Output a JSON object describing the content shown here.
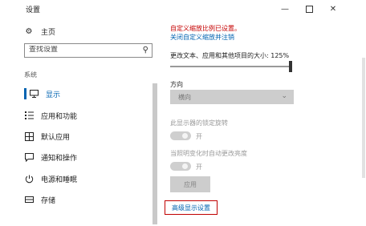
{
  "window": {
    "title": "设置"
  },
  "titlebar": {
    "minimize_glyph": "—",
    "close_glyph": "✕"
  },
  "sidebar": {
    "home_label": "主页",
    "search_placeholder": "查找设置",
    "section": "系统",
    "items": [
      {
        "label": "显示",
        "icon": "monitor-icon",
        "active": true
      },
      {
        "label": "应用和功能",
        "icon": "apps-list-icon"
      },
      {
        "label": "默认应用",
        "icon": "default-apps-icon"
      },
      {
        "label": "通知和操作",
        "icon": "notification-icon"
      },
      {
        "label": "电源和睡眠",
        "icon": "power-icon"
      },
      {
        "label": "存储",
        "icon": "storage-icon"
      }
    ]
  },
  "content": {
    "custom_scale_warning": "自定义缩放比例已设置。",
    "turn_off_custom_scale_link": "关闭自定义缩放并注销",
    "scale_label": "更改文本、应用和其他项目的大小: 125%",
    "scale_percent": 125,
    "orientation_label": "方向",
    "orientation_value": "横向",
    "rotation_lock_label": "此显示器的锁定旋转",
    "rotation_lock_state": "开",
    "auto_change_label": "当照明变化时自动更改亮度",
    "auto_change_state": "开",
    "apply_button": "应用",
    "advanced_display_link": "高级显示设置"
  },
  "colors": {
    "accent": "#0063b1",
    "warning": "#c50000",
    "highlight_border": "#c00000"
  }
}
